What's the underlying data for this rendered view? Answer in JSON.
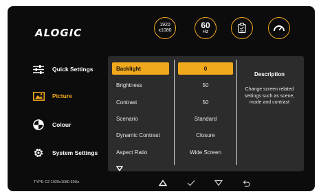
{
  "brand": {
    "logo": "ALOGIC"
  },
  "status": {
    "resolution": {
      "line1": "1920",
      "line2": "x1080"
    },
    "refresh": {
      "value": "60",
      "unit": "Hz"
    }
  },
  "colors": {
    "accent": "#f0a81c",
    "background": "#0c0c0c",
    "panel": "#2c2c2c"
  },
  "sidebar": {
    "items": [
      {
        "label": "Quick Settings",
        "icon": "sliders-icon"
      },
      {
        "label": "Picture",
        "icon": "image-icon",
        "active": true
      },
      {
        "label": "Colour",
        "icon": "palette-icon"
      },
      {
        "label": "System Settings",
        "icon": "gear-icon"
      }
    ]
  },
  "menu": {
    "items": [
      {
        "label": "Backlight",
        "value": "0",
        "selected": true
      },
      {
        "label": "Brightness",
        "value": "50"
      },
      {
        "label": "Contrast",
        "value": "50"
      },
      {
        "label": "Scenario",
        "value": "Standard"
      },
      {
        "label": "Dynamic Contrast",
        "value": "Closure"
      },
      {
        "label": "Aspect Ratio",
        "value": "Wide Screen"
      }
    ]
  },
  "description": {
    "title": "Description",
    "text": "Change screen related settings such as scene, mode and contrast"
  },
  "footer": {
    "info": "TYPE-C2   1920x1080 60Hz"
  },
  "nav": [
    "up-icon",
    "check-icon",
    "down-icon",
    "back-icon"
  ]
}
